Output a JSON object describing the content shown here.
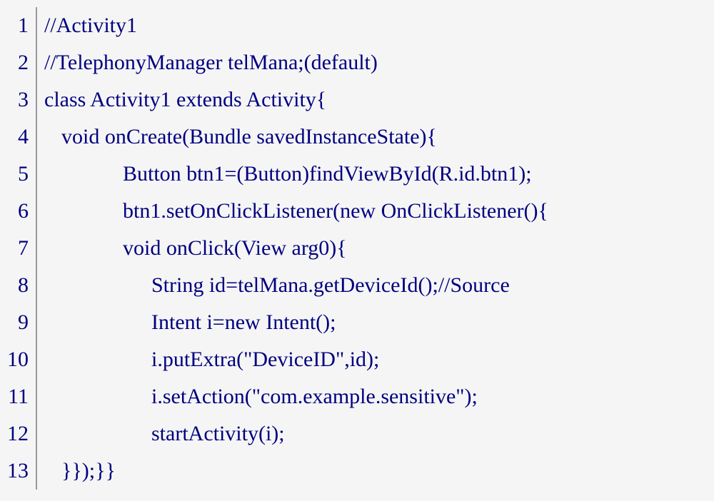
{
  "code": {
    "lines": [
      {
        "num": "1",
        "text": "//Activity1",
        "indent": 0
      },
      {
        "num": "2",
        "text": "//TelephonyManager telMana;(default)",
        "indent": 0
      },
      {
        "num": "3",
        "text": "class Activity1 extends Activity{",
        "indent": 0
      },
      {
        "num": "4",
        "text": "void onCreate(Bundle savedInstanceState){",
        "indent": 1
      },
      {
        "num": "5",
        "text": "Button btn1=(Button)findViewById(R.id.btn1);",
        "indent": 2
      },
      {
        "num": "6",
        "text": "btn1.setOnClickListener(new OnClickListener(){",
        "indent": 2
      },
      {
        "num": "7",
        "text": "void onClick(View arg0){",
        "indent": 2
      },
      {
        "num": "8",
        "text": "String id=telMana.getDeviceId();//Source",
        "indent": 3
      },
      {
        "num": "9",
        "text": "Intent i=new Intent();",
        "indent": 3
      },
      {
        "num": "10",
        "text": "i.putExtra(\"DeviceID\",id);",
        "indent": 3
      },
      {
        "num": "11",
        "text": "i.setAction(\"com.example.sensitive\");",
        "indent": 3
      },
      {
        "num": "12",
        "text": "startActivity(i);",
        "indent": 3
      },
      {
        "num": "13",
        "text": "}});}}",
        "indent": 1
      }
    ]
  }
}
